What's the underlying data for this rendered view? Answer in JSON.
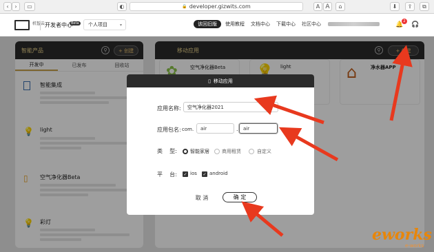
{
  "browser": {
    "url": "developer.gizwits.com",
    "font_small": "A",
    "font_large": "A"
  },
  "topnav": {
    "logo_text": "机智云",
    "title": "开发者中心",
    "beta": "Beta",
    "project_select": "个人项目",
    "items": [
      {
        "label": "该回旧版"
      },
      {
        "label": "使用教程"
      },
      {
        "label": "文档中心"
      },
      {
        "label": "下载中心"
      },
      {
        "label": "社区中心"
      }
    ],
    "notification_count": "2"
  },
  "left_panel": {
    "title": "智能产品",
    "create": "+ 创建",
    "tabs": [
      "开发中",
      "已发布",
      "回收站"
    ],
    "products": [
      {
        "name": "智能集成"
      },
      {
        "name": "light"
      },
      {
        "name": "空气净化器Beta"
      },
      {
        "name": "彩灯"
      }
    ]
  },
  "right_panel": {
    "title": "移动应用",
    "create": "+ 创建",
    "cards": [
      {
        "name": "空气净化器Beta"
      },
      {
        "name": "light"
      },
      {
        "name": "净水器APP"
      }
    ]
  },
  "modal": {
    "title": "移动应用",
    "app_name_label": "应用名称:",
    "app_name_value": "空气净化器2021",
    "package_label": "应用包名:",
    "package_prefix": "com.",
    "package_part1": "air",
    "package_dot": ".",
    "package_part2": "air",
    "type_label": "类    型:",
    "type_options": [
      "智能家居",
      "商用租赁",
      "自定义"
    ],
    "type_selected": "智能家居",
    "platform_label": "平    台:",
    "platform_options": [
      "ios",
      "android"
    ],
    "cancel": "取 消",
    "confirm": "确 定"
  },
  "watermark": {
    "logo": "eworks",
    "sub": "e-works"
  },
  "colors": {
    "accent": "#c9a24a",
    "header_dark": "#2a2a2a",
    "arrow": "#e8391e"
  }
}
